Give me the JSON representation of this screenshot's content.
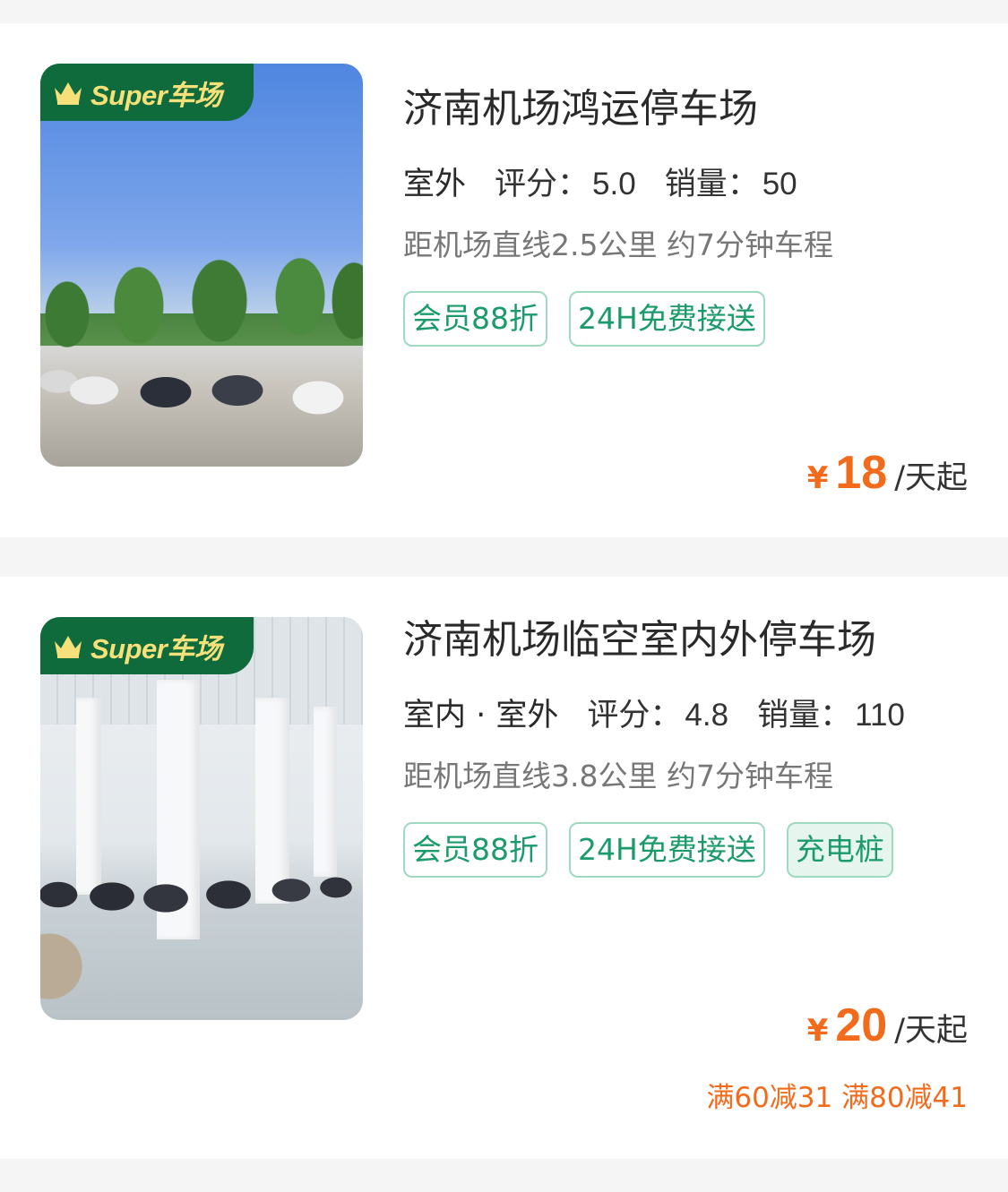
{
  "lots": [
    {
      "badge": "Super车场",
      "name": "济南机场鸿运停车场",
      "space_type": "室外",
      "rating_label": "评分：",
      "rating": "5.0",
      "sales_label": "销量：",
      "sales": "50",
      "distance": "距机场直线2.5公里 约7分钟车程",
      "tags": [
        "会员88折",
        "24H免费接送"
      ],
      "price_symbol": "¥",
      "price": "18",
      "price_unit": "/天起"
    },
    {
      "badge": "Super车场",
      "name": "济南机场临空室内外停车场",
      "space_type": "室内 · 室外",
      "rating_label": "评分：",
      "rating": "4.8",
      "sales_label": "销量：",
      "sales": "110",
      "distance": "距机场直线3.8公里 约7分钟车程",
      "tags": [
        "会员88折",
        "24H免费接送",
        "充电桩"
      ],
      "price_symbol": "¥",
      "price": "20",
      "price_unit": "/天起",
      "promo": "满60减31 满80减41"
    }
  ],
  "colors": {
    "accent_green": "#1b9b6b",
    "badge_green": "#0f6b3b",
    "badge_text": "#f6e07a",
    "price_orange": "#f26b1d"
  },
  "icons": {
    "badge": "crown-icon"
  }
}
